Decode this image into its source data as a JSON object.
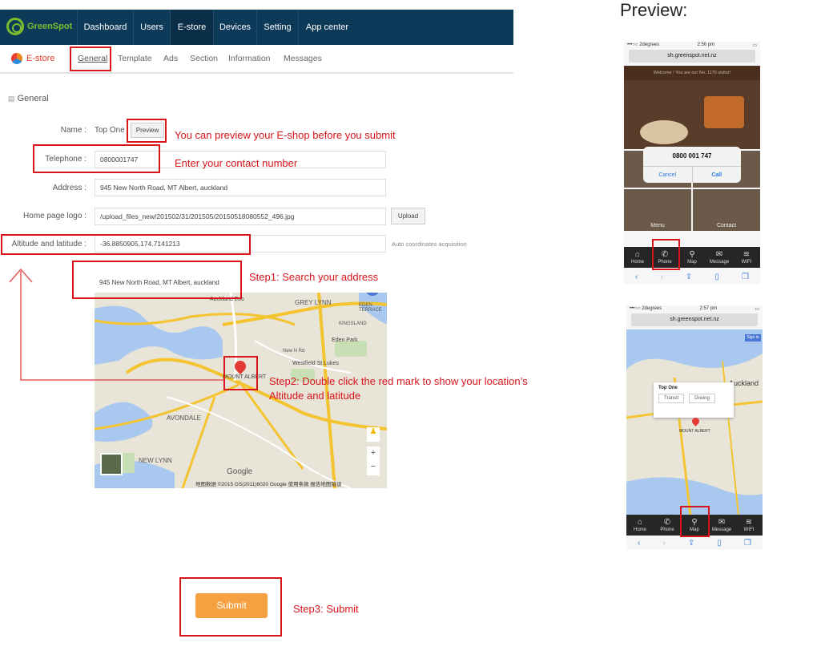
{
  "brand": {
    "name": "GreenSpot"
  },
  "topnav": {
    "items": [
      "Dashboard",
      "Users",
      "E-store",
      "Devices",
      "Setting",
      "App center"
    ],
    "active": "E-store"
  },
  "subnav": {
    "section_label": "E-store",
    "tabs": [
      "General",
      "Template",
      "Ads",
      "Section",
      "Information",
      "Messages"
    ],
    "active": "General"
  },
  "form": {
    "heading": "General",
    "name_label": "Name :",
    "name_value": "Top One",
    "preview_button": "Preview",
    "telephone_label": "Telephone :",
    "telephone_value": "0800001747",
    "address_label": "Address :",
    "address_value": "945 New North Road, MT Albert, auckland",
    "logo_label": "Home page logo :",
    "logo_value": "/upload_files_new/201502/31/201505/20150518080552_496.jpg",
    "upload_button": "Upload",
    "coords_label": "Altitude and latitude :",
    "coords_value": "-36.8850905,174.7141213",
    "coords_hint": "Auto coordinates acquisition",
    "map_search_value": "945 New North Road, MT Albert, auckland",
    "submit_button": "Submit"
  },
  "map": {
    "places": [
      "Auckland Zoo",
      "GREY LYNN",
      "EDEN TERRACE",
      "KINGSLAND",
      "Eden Park",
      "Westfield St Lukes",
      "MOUNT ALBERT",
      "AVONDALE",
      "NEW LYNN",
      "New N Rd"
    ],
    "attribution": "地图数据 ©2015 GS(2011)6020 Google  使用条款  报告地图错误",
    "google": "Google"
  },
  "annotations": {
    "preview": "You can preview your E-shop before you submit",
    "telephone": "Enter your contact number",
    "step1": "Step1: Search your address",
    "step2_line1": "Step2: Double click the red mark to show your location’s",
    "step2_line2": "Altitude and latitude",
    "step3": "Step3: Submit"
  },
  "preview": {
    "title": "Preview:",
    "phone1": {
      "carrier": "•••○○ 2degrees",
      "time": "2:56 pm",
      "url": "sh.greenspot.net.nz",
      "welcome": "Welcome ! You are our No. 1176 visitor!",
      "dialog_number": "0800 001 747",
      "cancel": "Cancel",
      "call": "Call",
      "tiles": [
        "Menu",
        "Contact"
      ]
    },
    "phone2": {
      "carrier": "•••○○ 2degrees",
      "time": "2:57 pm",
      "url": "sh.greenspot.net.nz",
      "popup_title": "Top One",
      "transit": "Transit",
      "driving": "Driving",
      "signin": "Sign in",
      "places": [
        "Auckland",
        "MOUNT ALBERT"
      ]
    },
    "tabs": [
      "Home",
      "Phone",
      "Map",
      "Message",
      "WIFI"
    ]
  },
  "colors": {
    "nav_bg": "#0e3a5a",
    "accent_red": "#d9141b",
    "submit": "#f5a142",
    "brand_green": "#7dbb2f"
  }
}
